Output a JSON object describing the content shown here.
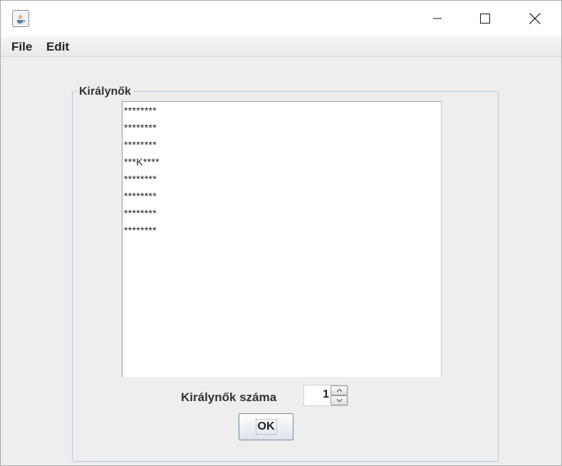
{
  "window": {
    "title": "",
    "controls": {
      "minimize": "minimize-icon",
      "maximize": "maximize-icon",
      "close": "close-icon"
    }
  },
  "menubar": {
    "items": [
      {
        "label": "File"
      },
      {
        "label": "Edit"
      }
    ]
  },
  "group": {
    "title": "Királynők"
  },
  "board": {
    "rows": [
      "********",
      "********",
      "********",
      "***K****",
      "********",
      "********",
      "********",
      "********"
    ]
  },
  "controls": {
    "count_label": "Királynők száma",
    "count_value": "1",
    "ok_label": "OK"
  }
}
